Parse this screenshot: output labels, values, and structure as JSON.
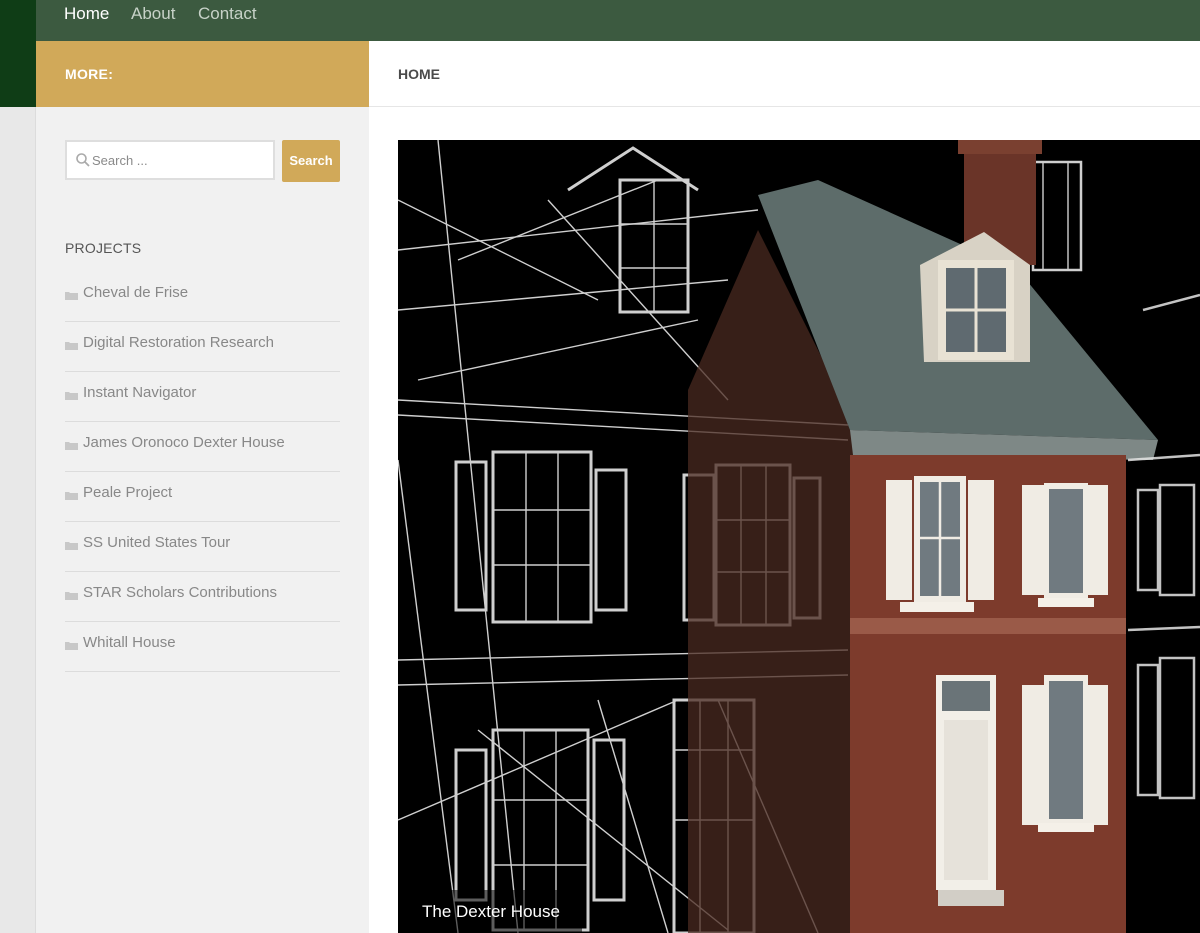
{
  "nav": {
    "items": [
      {
        "label": "Home",
        "active": true
      },
      {
        "label": "About",
        "active": false
      },
      {
        "label": "Contact",
        "active": false
      }
    ]
  },
  "sidebar": {
    "header": "MORE:",
    "search": {
      "placeholder": "Search ...",
      "button_label": "Search"
    },
    "projects_title": "PROJECTS",
    "projects": [
      "Cheval de Frise",
      "Digital Restoration Research",
      "Instant Navigator",
      "James Oronoco Dexter House",
      "Peale Project",
      "SS United States Tour",
      "STAR Scholars Contributions",
      "Whitall House"
    ]
  },
  "main": {
    "breadcrumb": "HOME",
    "hero_caption": "The Dexter House"
  },
  "colors": {
    "nav_bg": "#3c5a40",
    "dark_green": "#0f3d16",
    "gold": "#d1a959"
  }
}
